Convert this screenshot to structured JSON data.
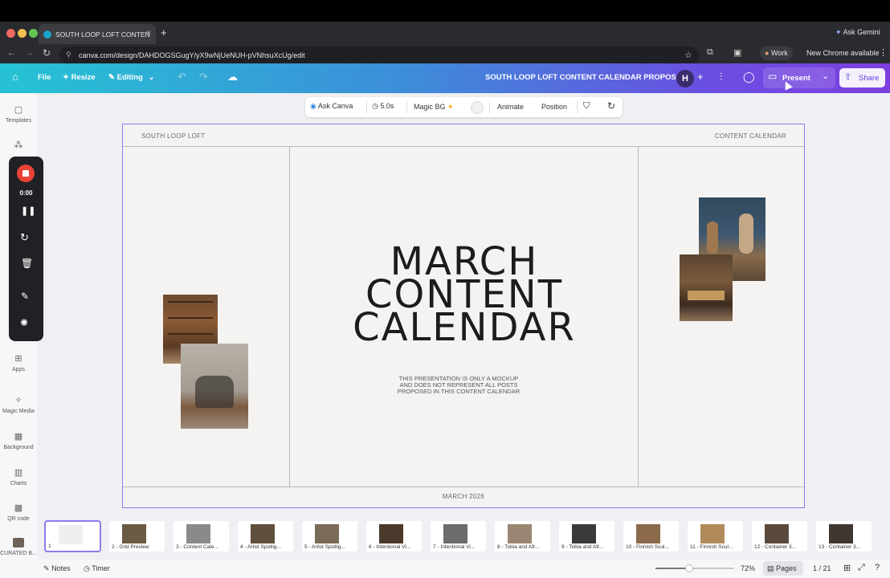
{
  "browser": {
    "tab_title": "SOUTH LOOP LOFT CONTEN",
    "tab_close": "×",
    "new_tab": "+",
    "ask_gemini": "Ask Gemini",
    "url": "canva.com/design/DAHDOGSGugY/yX9wNjUeNUH-pVNhsuXcUg/edit",
    "profile": "Work",
    "update": "New Chrome available"
  },
  "canva_header": {
    "file": "File",
    "resize": "Resize",
    "editing": "Editing",
    "doc_title": "SOUTH LOOP LOFT CONTENT CALENDAR PROPOSAL",
    "avatar": "H",
    "present": "Present",
    "share": "Share"
  },
  "sidebar": {
    "items": [
      "Templates",
      "Apps",
      "Magic Media",
      "Background",
      "Charts",
      "QR code",
      "CURATED B..."
    ]
  },
  "recorder": {
    "time": "0:00"
  },
  "toolbar": {
    "ask_canva": "Ask Canva",
    "duration": "5.0s",
    "magic_bg": "Magic BG",
    "animate": "Animate",
    "position": "Position"
  },
  "slide": {
    "top_left": "SOUTH LOOP LOFT",
    "top_right": "CONTENT CALENDAR",
    "title_lines": [
      "MARCH",
      "CONTENT",
      "CALENDAR"
    ],
    "note_lines": [
      "THIS PRESENTATION IS ONLY A MOCKUP",
      "AND DOES NOT REPRESENT ALL POSTS",
      "PROPOSED IN THIS CONTENT CALENDAR"
    ],
    "footer": "MARCH 2026"
  },
  "pages": [
    {
      "label": "1",
      "color": "#efefef"
    },
    {
      "label": "2 - Grid Preview",
      "color": "#6b5a44"
    },
    {
      "label": "3 - Content Cale...",
      "color": "#8a8a8a"
    },
    {
      "label": "4 - Artist Spotlig...",
      "color": "#5e4e3c"
    },
    {
      "label": "5 - Artist Spotlig...",
      "color": "#7a6a58"
    },
    {
      "label": "6 - Intentional Vi...",
      "color": "#4a3a2c"
    },
    {
      "label": "7 - Intentional Vi...",
      "color": "#6c6c6c"
    },
    {
      "label": "8 - Tobia and Afr...",
      "color": "#9a8672"
    },
    {
      "label": "9 - Tobia and Afr...",
      "color": "#3a3a3a"
    },
    {
      "label": "10 - Finnish Scul...",
      "color": "#8a6a4a"
    },
    {
      "label": "11 - Finnish Scul...",
      "color": "#b08a5a"
    },
    {
      "label": "12 - Container 3...",
      "color": "#5a4a3e"
    },
    {
      "label": "13 - Container 3...",
      "color": "#3e3630"
    }
  ],
  "bottom": {
    "notes": "Notes",
    "timer": "Timer",
    "zoom": "72%",
    "zoom_level": 0.72,
    "pages_btn": "Pages",
    "page_count": "1 / 21"
  },
  "colors": {
    "chrome_bg": "#2a2b2e",
    "canva_gradient_start": "#26c3d4",
    "canva_gradient_end": "#7d3fe0",
    "slide_selection": "#8b7cf0",
    "record_red": "#ea4335"
  }
}
